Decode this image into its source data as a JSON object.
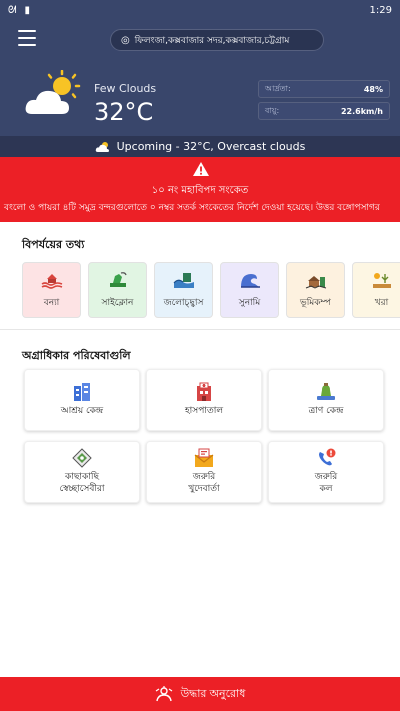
{
  "statusbar": {
    "time": "1:29"
  },
  "header": {
    "location": "ফিলংজা,কক্সবাজার সদর,কক্সবাজার,চট্টগ্রাম",
    "condition": "Few Clouds",
    "temperature": "32°C",
    "humidity_label": "আর্দ্রতা:",
    "humidity_value": "48%",
    "wind_label": "বায়ু:",
    "wind_value": "22.6km/h"
  },
  "upcoming": {
    "text": "Upcoming - 32°C, Overcast clouds"
  },
  "alert": {
    "title": "১০ নং মহাবিপদ সংকেত",
    "message": "বংলো ও পায়রা ৪টি সমুদ্র বন্দরগুলোতে ০ নম্বর সতর্ক সংকেতের নির্দেশ দেওয়া হয়েছে। উত্তর বঙ্গোপসাগর"
  },
  "disaster_section": {
    "title": "বিপর্যয়ের তথ্য",
    "items": [
      {
        "label": "বন্যা",
        "icon": "flood-icon",
        "bg": "#fde3e4"
      },
      {
        "label": "সাইক্লোন",
        "icon": "cyclone-icon",
        "bg": "#e1f5e3"
      },
      {
        "label": "জলোচ্ছ্বাস",
        "icon": "tidal-surge-icon",
        "bg": "#e6f2fb"
      },
      {
        "label": "সুনামি",
        "icon": "tsunami-icon",
        "bg": "#ece8fb"
      },
      {
        "label": "ভূমিকম্প",
        "icon": "earthquake-icon",
        "bg": "#fdf1df"
      },
      {
        "label": "খরা",
        "icon": "drought-icon",
        "bg": "#fdf6e3"
      }
    ]
  },
  "services_section": {
    "title": "অগ্রাধিকার পরিষেবাগুলি",
    "items": [
      {
        "label": "আশ্রয় কেন্দ্র",
        "icon": "shelter-icon"
      },
      {
        "label": "হাসপাতাল",
        "icon": "hospital-icon"
      },
      {
        "label": "ত্রাণ কেন্দ্র",
        "icon": "relief-center-icon"
      },
      {
        "label": "কাছাকাছি\nস্বেচ্ছাসেবীরা",
        "icon": "volunteers-icon"
      },
      {
        "label": "জরুরি\nখুদেবার্তা",
        "icon": "emergency-sms-icon"
      },
      {
        "label": "জরুরি\nকল",
        "icon": "emergency-call-icon"
      }
    ]
  },
  "rescue_button": {
    "label": "উদ্ধার অনুরোধ",
    "icon": "rescue-icon"
  },
  "colors": {
    "header": "#39466b",
    "alert": "#ec2026",
    "accent": "#ec2026"
  }
}
